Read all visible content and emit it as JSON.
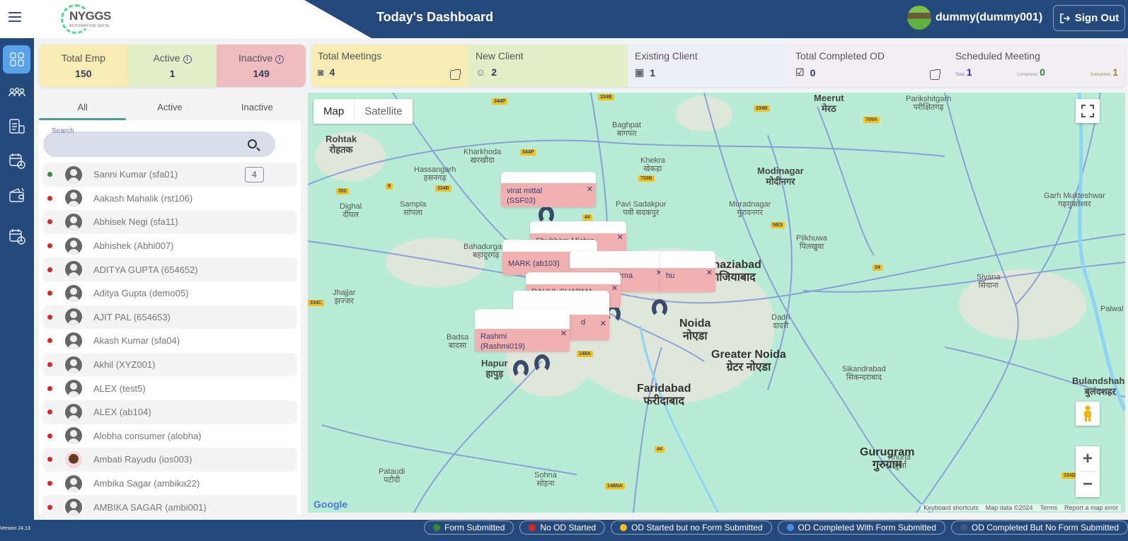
{
  "header": {
    "title": "Today's Dashboard",
    "logo_text": "NYGGS",
    "logo_subtext": "AUTOMATION SUITE",
    "user_name": "dummy(dummy001)",
    "signout_label": "Sign Out"
  },
  "rail": {
    "items": [
      {
        "icon": "dashboard-icon",
        "active": true
      },
      {
        "icon": "team-icon"
      },
      {
        "icon": "reports-icon"
      },
      {
        "icon": "calendar-clock-icon"
      },
      {
        "icon": "wallet-icon"
      },
      {
        "icon": "schedule-icon"
      }
    ]
  },
  "stats": {
    "total_emp": {
      "label": "Total Emp",
      "value": "150"
    },
    "active": {
      "label": "Active",
      "value": "1"
    },
    "inactive": {
      "label": "Inactive",
      "value": "149"
    },
    "total_meetings": {
      "label": "Total Meetings",
      "value": "4"
    },
    "new_client": {
      "label": "New Client",
      "value": "2"
    },
    "existing_client": {
      "label": "Existing Client",
      "value": "1"
    },
    "completed_od": {
      "label": "Total Completed OD",
      "value": "0"
    },
    "scheduled_meeting": {
      "label": "Scheduled Meeting",
      "total_label": "Total",
      "total": "1",
      "completed_label": "Completed",
      "completed": "0",
      "scheduled_label": "Scheduled",
      "scheduled": "1"
    }
  },
  "panel": {
    "tabs": [
      "All",
      "Active",
      "Inactive"
    ],
    "active_tab": "All",
    "search_label": "Search",
    "search_value": "",
    "employees": [
      {
        "name": "Sanni Kumar (sfa01)",
        "status": "active",
        "count": "4"
      },
      {
        "name": "Aakash Mahalik (rst106)",
        "status": "inactive"
      },
      {
        "name": "Abhisek Negi (sfa11)",
        "status": "inactive"
      },
      {
        "name": "Abhishek (Abhi007)",
        "status": "inactive"
      },
      {
        "name": "ADITYA GUPTA (654652)",
        "status": "inactive"
      },
      {
        "name": "Aditya Gupta (demo05)",
        "status": "inactive"
      },
      {
        "name": "AJIT PAL (654653)",
        "status": "inactive"
      },
      {
        "name": "Akash Kumar (sfa04)",
        "status": "inactive"
      },
      {
        "name": "Akhil (XYZ001)",
        "status": "inactive"
      },
      {
        "name": "ALEX (test5)",
        "status": "inactive"
      },
      {
        "name": "ALEX (ab104)",
        "status": "inactive"
      },
      {
        "name": "Alobha consumer (alobha)",
        "status": "inactive"
      },
      {
        "name": "Ambati Rayudu (ios003)",
        "status": "inactive",
        "photo": true
      },
      {
        "name": "Ambika Sagar (ambika22)",
        "status": "inactive"
      },
      {
        "name": "AMBIKA SAGAR (ambi001)",
        "status": "inactive"
      }
    ]
  },
  "map": {
    "type_buttons": [
      "Map",
      "Satellite"
    ],
    "selected_type": "Map",
    "info_windows": [
      {
        "line1": "virat mittal",
        "line2": "(SSF03)"
      },
      {
        "line1": "Shubham Mishra",
        "line2": ""
      },
      {
        "line1": "MARK (ab103)",
        "line2": ""
      },
      {
        "line1": "arma",
        "line2": ""
      },
      {
        "line1": "hu",
        "line2": ""
      },
      {
        "line1": "RAHUL SHARMA",
        "line2": ""
      },
      {
        "line1": "d",
        "line2": ""
      },
      {
        "line1": "Rashmi",
        "line2": "(Rashmi019)"
      }
    ],
    "places": [
      {
        "n": "Rohtak",
        "h": "रोहतक",
        "cls": "mid"
      },
      {
        "n": "Meerut",
        "h": "मेरठ",
        "cls": "mid"
      },
      {
        "n": "Modinagar",
        "h": "मोदीनगर",
        "cls": "mid"
      },
      {
        "n": "Ghaziabad",
        "h": "गाजियाबाद",
        "cls": "big"
      },
      {
        "n": "Noida",
        "h": "नोएडा",
        "cls": "big"
      },
      {
        "n": "Greater Noida",
        "h": "ग्रेटर नोएडा",
        "cls": "big"
      },
      {
        "n": "Faridabad",
        "h": "फरीदाबाद",
        "cls": "big"
      },
      {
        "n": "Hapur",
        "h": "हापुड़",
        "cls": "mid"
      },
      {
        "n": "Bulandshahr",
        "h": "बुलंदशहर",
        "cls": "mid"
      },
      {
        "n": "Gurugram",
        "h": "गुरुग्राम",
        "cls": "big"
      },
      {
        "n": "Kharkhoda",
        "h": "खरखौदा",
        "cls": ""
      },
      {
        "n": "Hassangarh",
        "h": "हसनगढ़",
        "cls": ""
      },
      {
        "n": "Sampla",
        "h": "सांपला",
        "cls": ""
      },
      {
        "n": "Bahadurgarh",
        "h": "बहादुरगढ़",
        "cls": ""
      },
      {
        "n": "Jhajjar",
        "h": "झज्जर",
        "cls": ""
      },
      {
        "n": "Baghpat",
        "h": "बागपत",
        "cls": ""
      },
      {
        "n": "Khekra",
        "h": "खेकड़ा",
        "cls": ""
      },
      {
        "n": "Pavi Sadakpur",
        "h": "पवी सदकपुर",
        "cls": ""
      },
      {
        "n": "Muradnagar",
        "h": "मुरादनगर",
        "cls": ""
      },
      {
        "n": "Pilkhuwa",
        "h": "पिलखुवा",
        "cls": ""
      },
      {
        "n": "Dadri",
        "h": "दादरी",
        "cls": ""
      },
      {
        "n": "Sikandrabad",
        "h": "सिकन्दराबाद",
        "cls": ""
      },
      {
        "n": "Parikshitgarh",
        "h": "परीक्षितगढ़",
        "cls": ""
      },
      {
        "n": "Garh Mukteshwar",
        "h": "गढ़मुक्तेश्वर",
        "cls": ""
      },
      {
        "n": "Siyana",
        "h": "सियाना",
        "cls": ""
      },
      {
        "n": "Khurja",
        "h": "खुर्जा",
        "cls": ""
      },
      {
        "n": "Palwal",
        "h": "",
        "cls": ""
      },
      {
        "n": "Sohna",
        "h": "सोहना",
        "cls": ""
      },
      {
        "n": "Pataudi",
        "h": "पटौदी",
        "cls": ""
      },
      {
        "n": "Dighal",
        "h": "दीघल",
        "cls": ""
      },
      {
        "n": "Badsa",
        "h": "बादसा",
        "cls": ""
      }
    ],
    "attribution": [
      "Keyboard shortcuts",
      "Map data ©2024",
      "Terms",
      "Report a map error"
    ],
    "google_label": "Google"
  },
  "footer": {
    "version": "Version 24.13",
    "legend": [
      {
        "label": "Form Submitted",
        "color": "#2e8b3a"
      },
      {
        "label": "No OD Started",
        "color": "#e02424"
      },
      {
        "label": "OD Started but no Form Submitted",
        "color": "#f2c21b"
      },
      {
        "label": "OD Completed With Form Submitted",
        "color": "#4a8ee0"
      },
      {
        "label": "OD Completed But No Form Submitted",
        "color": "#3e5a78"
      }
    ]
  }
}
